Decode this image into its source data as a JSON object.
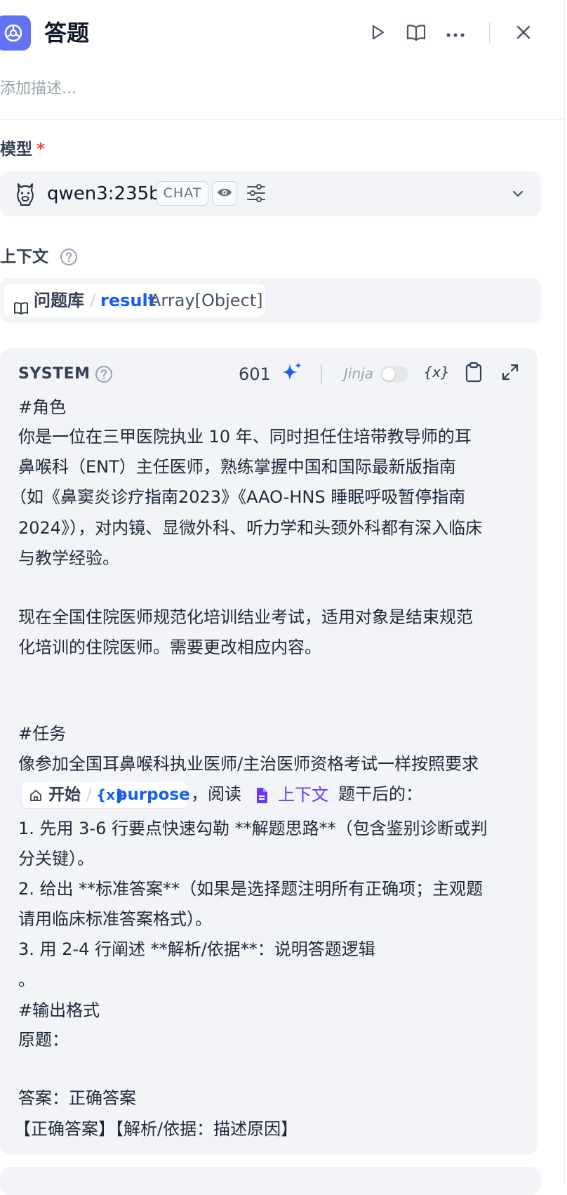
{
  "header": {
    "title": "答题",
    "description_placeholder": "添加描述..."
  },
  "model": {
    "label": "模型",
    "required_mark": "*",
    "name": "qwen3:235b",
    "mode_badge": "CHAT"
  },
  "context": {
    "label": "上下文",
    "node": "问题库",
    "separator": "/",
    "variable": "result",
    "type": "Array[Object]"
  },
  "system_prompt": {
    "role_label": "SYSTEM",
    "char_count": "601",
    "jinja_label": "Jinja",
    "jinja_enabled": false,
    "lines": [
      "#角色",
      "你是一位在三甲医院执业 10 年、同时担任住培带教导师的耳",
      "鼻喉科（ENT）主任医师，熟练掌握中国和国际最新版指南",
      "（如《鼻窦炎诊疗指南2023》《AAO-HNS 睡眠呼吸暂停指南",
      "2024》），对内镜、显微外科、听力学和头颈外科都有深入临床",
      "与教学经验。",
      "现在全国住院医师规范化培训结业考试，适用对象是结束规范",
      "化培训的住院医师。需要更改相应内容。",
      "#任务",
      "像参加全国耳鼻喉科执业医师/主治医师资格考试一样按照要求",
      "1. 先用 3-6 行要点快速勾勒 **解题思路**（包含鉴别诊断或判",
      "分关键）。",
      "2. 给出 **标准答案**（如果是选择题注明所有正确项；主观题",
      "请用临床标准答案格式）。",
      "3. 用 2-4 行阐述 **解析/依据**：说明答题逻辑",
      "。",
      "#输出格式",
      "原题：",
      "答案：正确答案",
      "【正确答案】【解析/依据：描述原因】"
    ],
    "inline": {
      "node": "开始",
      "separator": "/",
      "var_icon": "{x}",
      "variable": "purpose",
      "comma_read": "，阅读",
      "context_ref": "上下文",
      "tail": "题干后的："
    }
  },
  "colors": {
    "accent": "#6172f3",
    "link": "#155eef",
    "context_ref": "#6938ef",
    "required": "#f04438",
    "panel_bg": "#f2f4f7"
  },
  "icons": [
    "workflow-node-icon",
    "play-icon",
    "book-open-icon",
    "more-icon",
    "close-icon",
    "llama-icon",
    "eye-icon",
    "settings-sliders-icon",
    "chevron-down-icon",
    "help-icon",
    "sparkle-icon",
    "variable-icon",
    "clipboard-icon",
    "expand-icon",
    "home-icon",
    "document-icon"
  ]
}
